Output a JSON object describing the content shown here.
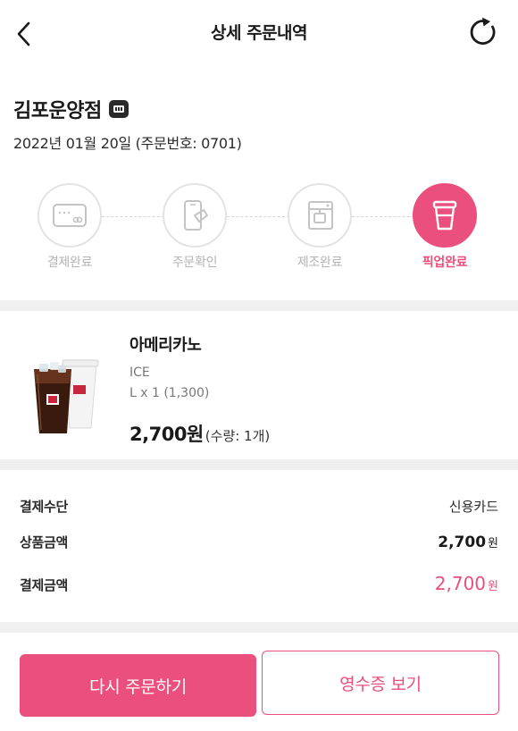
{
  "header": {
    "title": "상세 주문내역",
    "back_icon": "chevron-left-icon",
    "refresh_icon": "refresh-icon"
  },
  "store": {
    "name": "김포운양점",
    "badge_icon": "store-badge-icon",
    "order_info": "2022년 01월 20일 (주문번호: 0701)"
  },
  "steps": [
    {
      "label": "결제완료",
      "icon": "credit-card-icon",
      "active": false
    },
    {
      "label": "주문확인",
      "icon": "phone-order-icon",
      "active": false
    },
    {
      "label": "제조완료",
      "icon": "coffee-machine-icon",
      "active": false
    },
    {
      "label": "픽업완료",
      "icon": "coffee-cup-icon",
      "active": true
    }
  ],
  "product": {
    "name": "아메리카노",
    "option_temp": "ICE",
    "option_size": "L x 1 (1,300)",
    "price": "2,700원",
    "quantity": "(수량: 1개)"
  },
  "payment": {
    "method_label": "결제수단",
    "method_value": "신용카드",
    "product_amount_label": "상품금액",
    "product_amount": "2,700",
    "product_amount_unit": "원",
    "pay_amount_label": "결제금액",
    "pay_amount": "2,700",
    "pay_amount_unit": "원"
  },
  "buttons": {
    "reorder": "다시 주문하기",
    "receipt": "영수증 보기"
  },
  "colors": {
    "accent": "#eb4f7d",
    "inactive": "#b4b4b4",
    "divider": "#f0f0f0"
  }
}
